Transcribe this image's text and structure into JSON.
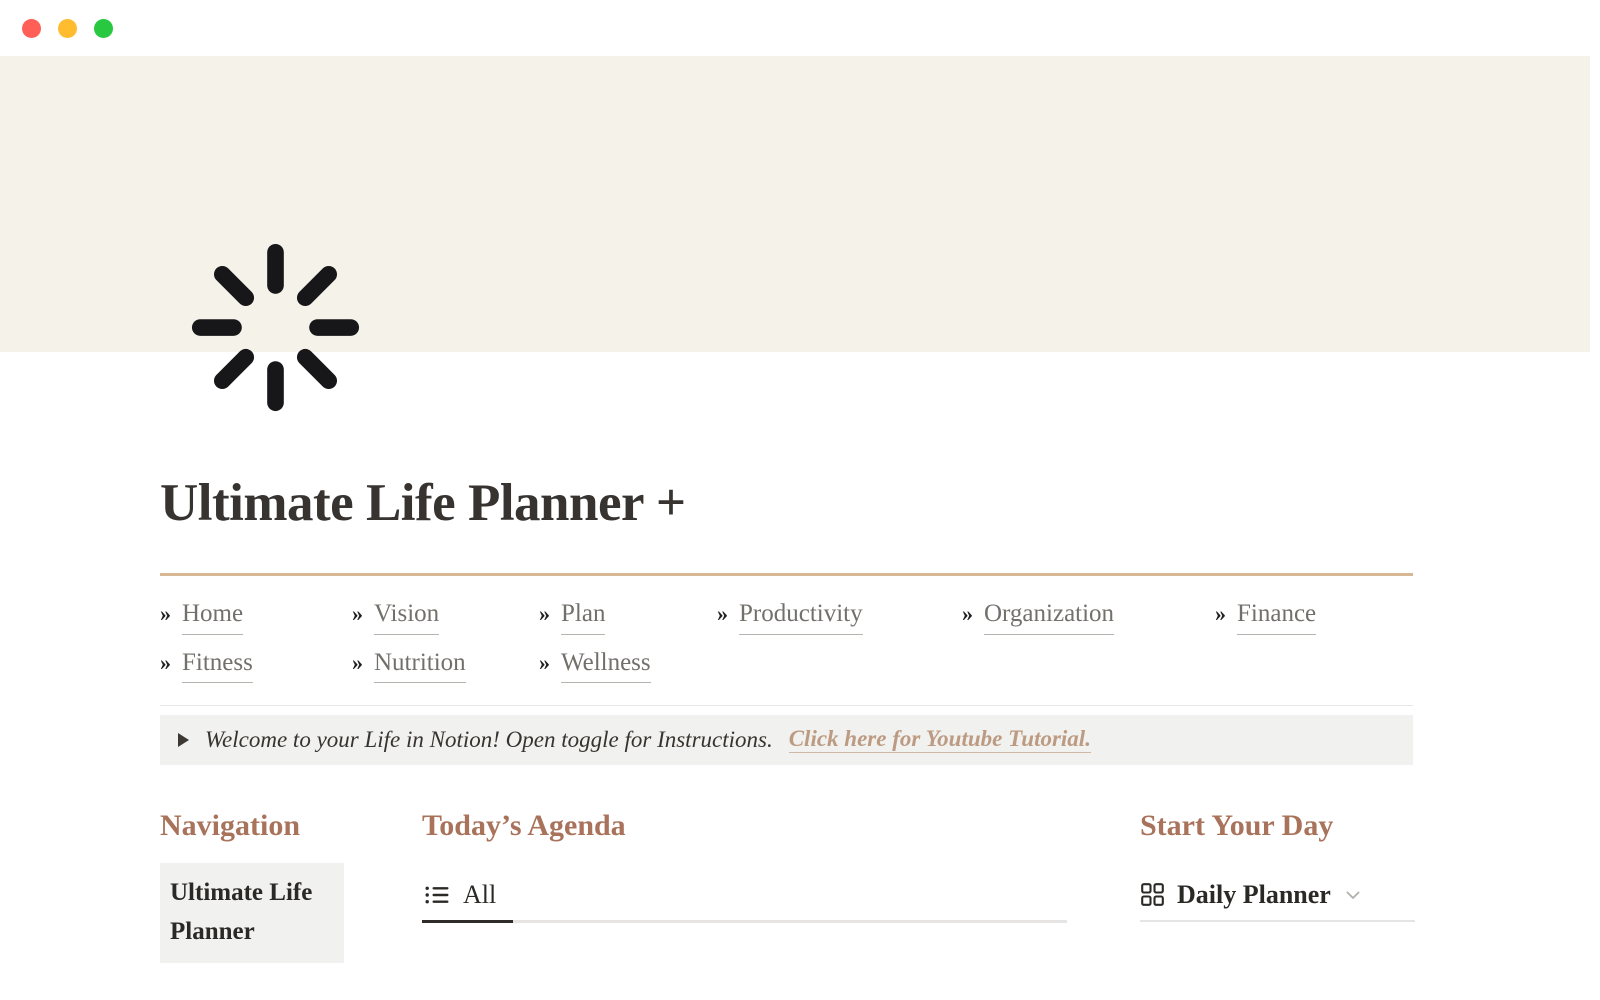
{
  "window": {
    "traffic_lights": [
      {
        "name": "close",
        "color": "#FF5F57"
      },
      {
        "name": "minimize",
        "color": "#FEBC2E"
      },
      {
        "name": "maximize",
        "color": "#28C840"
      }
    ]
  },
  "cover": {
    "background_color": "#F5F2EA",
    "page_icon": "spinner-icon"
  },
  "page": {
    "title": "Ultimate Life Planner +",
    "rule_color": "#D8B795"
  },
  "nav_links": [
    {
      "prefix": "»",
      "label": "Home"
    },
    {
      "prefix": "»",
      "label": "Vision"
    },
    {
      "prefix": "»",
      "label": "Plan"
    },
    {
      "prefix": "»",
      "label": "Productivity"
    },
    {
      "prefix": "»",
      "label": "Organization"
    },
    {
      "prefix": "»",
      "label": "Finance"
    },
    {
      "prefix": "»",
      "label": "Fitness"
    },
    {
      "prefix": "»",
      "label": "Nutrition"
    },
    {
      "prefix": "»",
      "label": "Wellness"
    }
  ],
  "callout": {
    "text": "Welcome to your Life in Notion! Open toggle for Instructions.",
    "link_text": "Click here for Youtube Tutorial.",
    "link_color": "#BC9B82",
    "background_color": "#F1F1EF"
  },
  "columns": {
    "navigation": {
      "heading": "Navigation",
      "items": [
        {
          "label": "Ultimate Life Planner"
        }
      ]
    },
    "agenda": {
      "heading": "Today’s Agenda",
      "tabs": [
        {
          "label": "All",
          "icon": "list-view-icon",
          "active": true
        }
      ]
    },
    "start_your_day": {
      "heading": "Start Your Day",
      "view": {
        "label": "Daily Planner",
        "icon": "gallery-view-icon",
        "chevron": "chevron-down-icon"
      }
    }
  },
  "accent_color": "#A9735B"
}
